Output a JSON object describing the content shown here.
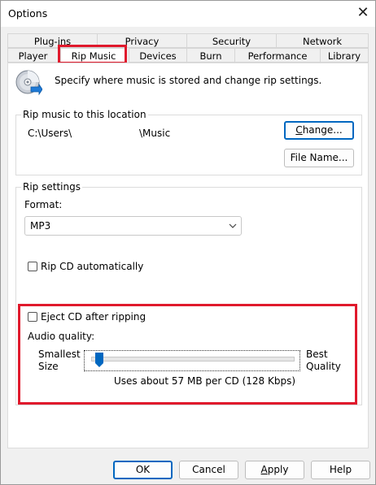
{
  "window": {
    "title": "Options"
  },
  "icons": {
    "close": "close-icon",
    "disc": "cd-disc-icon",
    "dropdown": "chevron-down-icon"
  },
  "tabs": {
    "row1": [
      {
        "label": "Plug-ins"
      },
      {
        "label": "Privacy"
      },
      {
        "label": "Security"
      },
      {
        "label": "Network"
      }
    ],
    "row2": [
      {
        "label": "Player"
      },
      {
        "label": "Rip Music",
        "active": true
      },
      {
        "label": "Devices"
      },
      {
        "label": "Burn"
      },
      {
        "label": "Performance"
      },
      {
        "label": "Library"
      }
    ]
  },
  "intro_text": "Specify where music is stored and change rip settings.",
  "rip_location": {
    "legend": "Rip music to this location",
    "path_start": "C:\\Users\\",
    "path_end": "\\Music",
    "change_label": "Change...",
    "filename_label": "File Name..."
  },
  "rip_settings": {
    "legend": "Rip settings",
    "format_label": "Format:",
    "format_value": "MP3",
    "rip_auto_label": "Rip CD automatically",
    "eject_label": "Eject CD after ripping",
    "audio_quality_label": "Audio quality:",
    "smallest_line1": "Smallest",
    "smallest_line2": "Size",
    "best_line1": "Best",
    "best_line2": "Quality",
    "quality_level": 0.02,
    "usage_text": "Uses about 57 MB per CD (128 Kbps)"
  },
  "footer": {
    "ok": "OK",
    "cancel": "Cancel",
    "apply": "Apply",
    "help": "Help"
  },
  "colors": {
    "highlight": "#e0192c",
    "accent": "#0067c0"
  }
}
